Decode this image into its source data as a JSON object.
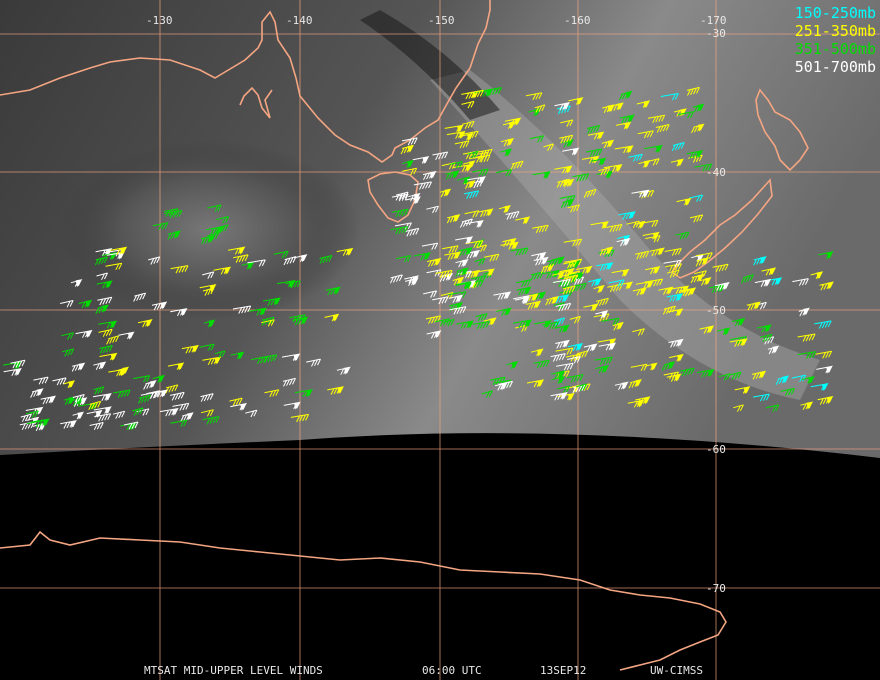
{
  "legend": [
    {
      "label": "150-250mb",
      "color": "#00ffff"
    },
    {
      "label": "251-350mb",
      "color": "#ffff00"
    },
    {
      "label": "351-500mb",
      "color": "#00dd00"
    },
    {
      "label": "501-700mb",
      "color": "#ffffff"
    }
  ],
  "longitude_labels": [
    "-130",
    "-140",
    "-150",
    "-160",
    "-170"
  ],
  "latitude_labels": [
    "-30",
    "-40",
    "-50",
    "-60",
    "-70"
  ],
  "footer": {
    "product": "MTSAT MID-UPPER LEVEL WINDS",
    "time": "06:00 UTC",
    "date": "13SEP12",
    "credit": "UW-CIMSS"
  },
  "colors": {
    "coastline": "#f4a582",
    "grid": "#f4a582",
    "space": "#000000"
  }
}
